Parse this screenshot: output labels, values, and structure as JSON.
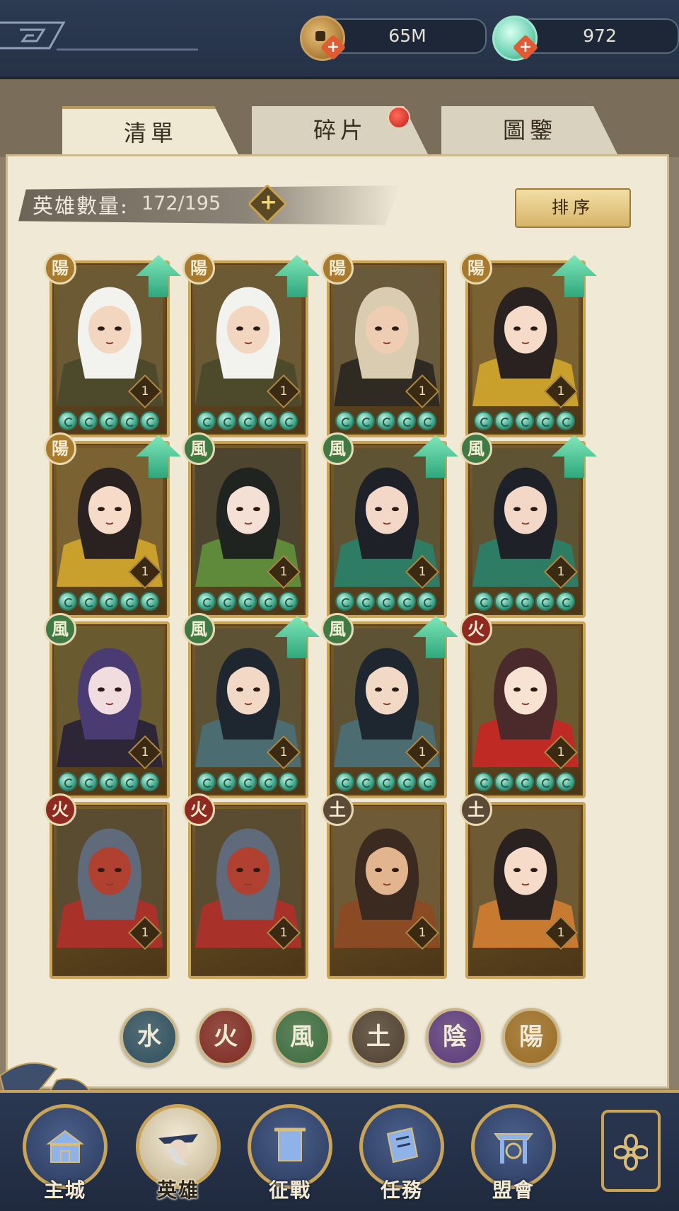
{
  "currencies": [
    {
      "name": "coins",
      "icon": "coin-icon",
      "value": "65M"
    },
    {
      "name": "jade",
      "icon": "jade-shell-icon",
      "value": "972"
    }
  ],
  "tabs": [
    {
      "label": "清單",
      "active": true
    },
    {
      "label": "碎片",
      "active": false,
      "badge": true
    },
    {
      "label": "圖鑒",
      "active": false
    }
  ],
  "hero_count": {
    "label": "英雄數量:",
    "value": "172/195"
  },
  "sort_label": "排序",
  "heroes": [
    {
      "element": "陽",
      "element_color": "#a87a2c",
      "level": "1",
      "stars": 5,
      "upgrade": true,
      "portrait": "white-haired-elder"
    },
    {
      "element": "陽",
      "element_color": "#a87a2c",
      "level": "1",
      "stars": 5,
      "upgrade": true,
      "portrait": "white-haired-elder"
    },
    {
      "element": "陽",
      "element_color": "#a87a2c",
      "level": "1",
      "stars": 5,
      "upgrade": false,
      "portrait": "blonde-warrior"
    },
    {
      "element": "陽",
      "element_color": "#a87a2c",
      "level": "1",
      "stars": 5,
      "upgrade": true,
      "portrait": "lady-with-fan"
    },
    {
      "element": "陽",
      "element_color": "#a87a2c",
      "level": "1",
      "stars": 5,
      "upgrade": true,
      "portrait": "lady-with-fan"
    },
    {
      "element": "風",
      "element_color": "#3f7a45",
      "level": "1",
      "stars": 5,
      "upgrade": false,
      "portrait": "green-robed-lady"
    },
    {
      "element": "風",
      "element_color": "#3f7a45",
      "level": "1",
      "stars": 5,
      "upgrade": true,
      "portrait": "teal-hairpin-lady"
    },
    {
      "element": "風",
      "element_color": "#3f7a45",
      "level": "1",
      "stars": 5,
      "upgrade": true,
      "portrait": "teal-hairpin-lady"
    },
    {
      "element": "風",
      "element_color": "#3f7a45",
      "level": "1",
      "stars": 5,
      "upgrade": false,
      "portrait": "purple-haired-girl"
    },
    {
      "element": "風",
      "element_color": "#3f7a45",
      "level": "1",
      "stars": 5,
      "upgrade": true,
      "portrait": "armored-scholar"
    },
    {
      "element": "風",
      "element_color": "#3f7a45",
      "level": "1",
      "stars": 5,
      "upgrade": true,
      "portrait": "armored-scholar"
    },
    {
      "element": "火",
      "element_color": "#8e2a20",
      "level": "1",
      "stars": 5,
      "upgrade": false,
      "portrait": "red-bun-girl"
    },
    {
      "element": "火",
      "element_color": "#8e2a20",
      "level": "1",
      "stars": 0,
      "upgrade": false,
      "portrait": "masked-warrior"
    },
    {
      "element": "火",
      "element_color": "#8e2a20",
      "level": "1",
      "stars": 0,
      "upgrade": false,
      "portrait": "masked-warrior"
    },
    {
      "element": "土",
      "element_color": "#5b4a36",
      "level": "1",
      "stars": 0,
      "upgrade": false,
      "portrait": "crowned-general"
    },
    {
      "element": "土",
      "element_color": "#5b4a36",
      "level": "1",
      "stars": 0,
      "upgrade": false,
      "portrait": "horned-lady"
    }
  ],
  "element_filters": [
    {
      "glyph": "水",
      "color": "#2e4f5e",
      "name": "water"
    },
    {
      "glyph": "火",
      "color": "#7e2a22",
      "name": "fire"
    },
    {
      "glyph": "風",
      "color": "#3b6b3e",
      "name": "wind"
    },
    {
      "glyph": "土",
      "color": "#4e4030",
      "name": "earth"
    },
    {
      "glyph": "陰",
      "color": "#5b3a7a",
      "name": "yin"
    },
    {
      "glyph": "陽",
      "color": "#9a6c24",
      "name": "yang"
    }
  ],
  "nav": [
    {
      "label": "主城",
      "icon": "palace-icon",
      "selected": false
    },
    {
      "label": "英雄",
      "icon": "hero-portrait-icon",
      "selected": true
    },
    {
      "label": "征戰",
      "icon": "scroll-icon",
      "selected": false
    },
    {
      "label": "任務",
      "icon": "task-book-icon",
      "selected": false
    },
    {
      "label": "盟會",
      "icon": "gate-icon",
      "selected": false
    }
  ],
  "menu_icon": "flower-menu-icon",
  "colors": {
    "accent_gold": "#c9a457",
    "panel": "#efe9d6",
    "nav_blue": "#2a3852",
    "upgrade_green": "#3fbf8c"
  }
}
